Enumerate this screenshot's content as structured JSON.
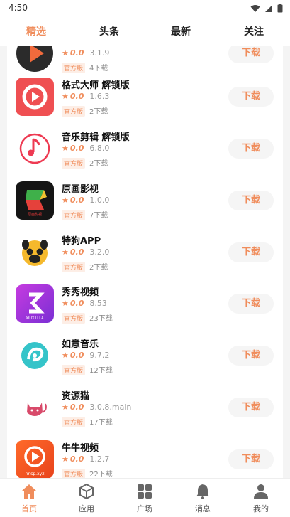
{
  "status": {
    "time": "4:50"
  },
  "tabs": [
    {
      "label": "精选",
      "active": true
    },
    {
      "label": "头条",
      "active": false
    },
    {
      "label": "最新",
      "active": false
    },
    {
      "label": "关注",
      "active": false
    }
  ],
  "apps": [
    {
      "name": "",
      "rating": "0.0",
      "version": "3.1.9",
      "badge": "官方版",
      "downloads": "4下载",
      "download_label": "下载",
      "icon": "play-icon"
    },
    {
      "name": "格式大师 解锁版",
      "rating": "0.0",
      "version": "1.6.3",
      "badge": "官方版",
      "downloads": "2下载",
      "download_label": "下载",
      "icon": "format-master-icon"
    },
    {
      "name": "音乐剪辑 解锁版",
      "rating": "0.0",
      "version": "6.8.0",
      "badge": "官方版",
      "downloads": "2下载",
      "download_label": "下载",
      "icon": "music-note-icon"
    },
    {
      "name": "原画影视",
      "rating": "0.0",
      "version": "1.0.0",
      "badge": "官方版",
      "downloads": "7下载",
      "download_label": "下载",
      "icon": "yuanhua-icon"
    },
    {
      "name": "特狗APP",
      "rating": "0.0",
      "version": "3.2.0",
      "badge": "官方版",
      "downloads": "2下载",
      "download_label": "下载",
      "icon": "pug-icon"
    },
    {
      "name": "秀秀视频",
      "rating": "0.0",
      "version": "8.53",
      "badge": "官方版",
      "downloads": "23下载",
      "download_label": "下载",
      "icon": "xiuxiu-icon"
    },
    {
      "name": "如意音乐",
      "rating": "0.0",
      "version": "9.7.2",
      "badge": "官方版",
      "downloads": "12下载",
      "download_label": "下载",
      "icon": "ruyi-icon"
    },
    {
      "name": "资源猫",
      "rating": "0.0",
      "version": "3.0.8.main",
      "badge": "官方版",
      "downloads": "17下载",
      "download_label": "下载",
      "icon": "cat-icon"
    },
    {
      "name": "牛牛视频",
      "rating": "0.0",
      "version": "1.2.7",
      "badge": "官方版",
      "downloads": "22下载",
      "download_label": "下载",
      "icon": "niuniu-icon"
    }
  ],
  "icon_texts": {
    "yuanhua": "原画影视",
    "xiuxiu": "XIUXIU.LA",
    "niuniu": "nnsp.xyz"
  },
  "nav": [
    {
      "label": "首页",
      "active": true,
      "icon": "home-icon"
    },
    {
      "label": "应用",
      "active": false,
      "icon": "box-icon"
    },
    {
      "label": "广场",
      "active": false,
      "icon": "grid-icon"
    },
    {
      "label": "消息",
      "active": false,
      "icon": "bell-icon"
    },
    {
      "label": "我的",
      "active": false,
      "icon": "user-icon"
    }
  ],
  "colors": {
    "accent": "#f08d5c",
    "badge_bg": "#fdeee6",
    "button_bg": "#f5f5f5"
  }
}
